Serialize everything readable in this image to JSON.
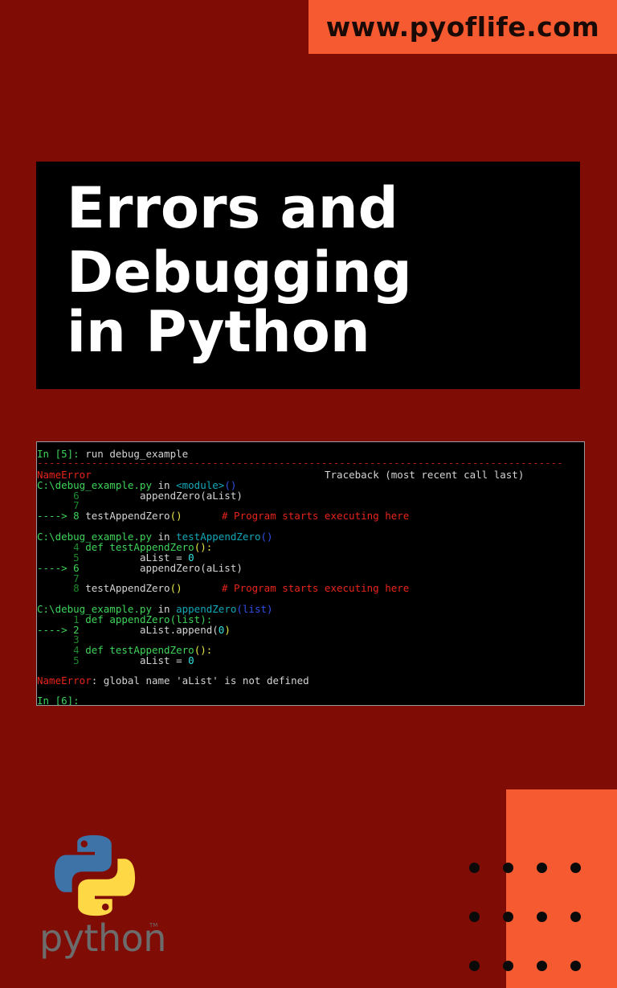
{
  "banner": {
    "url": "www.pyoflife.com"
  },
  "title": {
    "line1": "Errors and",
    "line2": "Debugging",
    "line3": "in Python"
  },
  "terminal": {
    "prompt_in5": "In [5]:",
    "cmd": " run debug_example",
    "separator": "---------------------------------------------------------------------------------------",
    "err_name": "NameError",
    "traceback_header": "Traceback (most recent call last)",
    "f1_path": "C:\\debug_example.py",
    "in_kw": " in ",
    "f1_func": "<module>",
    "f1_paren": "()",
    "f1_l6_num": "      6",
    "f1_l6_code": "          appendZero(aList)",
    "f1_l7_num": "      7",
    "arrow8": "----> 8",
    "f1_l8_code": " testAppendZero",
    "f1_l8_paren": "()",
    "comment": "# Program starts executing here",
    "f2_path": "C:\\debug_example.py",
    "f2_func": "testAppendZero",
    "f2_paren": "()",
    "f2_l4_num": "      4",
    "f2_l4_code": " def testAppendZero",
    "f2_l4_paren": "():",
    "f2_l5_num": "      5",
    "f2_l5_code": "          aList = ",
    "zero": "0",
    "arrow6": "----> 6",
    "f2_l6_code": "          appendZero(aList)",
    "f2_l7_num": "      7",
    "f2_l8_num": "      8",
    "f2_l8_code": " testAppendZero",
    "f2_l8_paren": "()",
    "f3_path": "C:\\debug_example.py",
    "f3_func": "appendZero",
    "f3_paren": "(list)",
    "f3_l1_num": "      1",
    "f3_l1_code": " def appendZero(list):",
    "arrow2": "----> 2",
    "f3_l2_code": "          aList.append(",
    "f3_l2_close": ")",
    "f3_l3_num": "      3",
    "f3_l4_num": "      4",
    "f3_l4_code": " def testAppendZero",
    "f3_l4_paren": "():",
    "f3_l5_num": "      5",
    "f3_l5_code": "          aList = ",
    "final_err_name": "NameError",
    "final_err_msg": ": global name 'aList' is not defined",
    "prompt_in6": "In [6]:"
  },
  "logo": {
    "wordmark": "python",
    "tm": "TM"
  },
  "colors": {
    "background": "#800c06",
    "accent": "#f65a31",
    "python_blue": "#3d73a6",
    "python_yellow": "#fed845"
  }
}
